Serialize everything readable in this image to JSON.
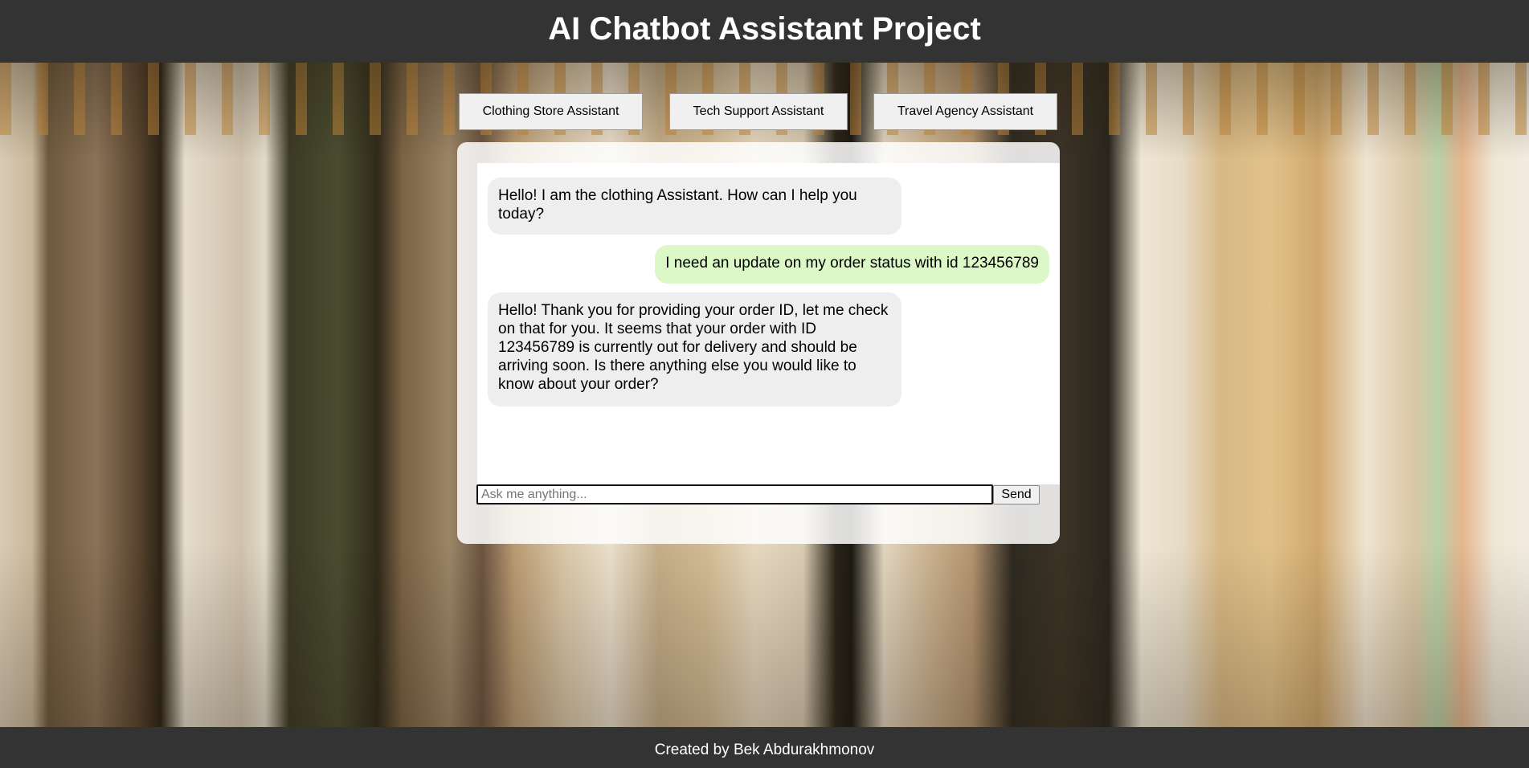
{
  "header": {
    "title": "AI Chatbot Assistant Project"
  },
  "tabs": [
    {
      "label": "Clothing Store Assistant"
    },
    {
      "label": "Tech Support Assistant"
    },
    {
      "label": "Travel Agency Assistant"
    }
  ],
  "chat": {
    "messages": [
      {
        "role": "bot",
        "text": "Hello! I am the clothing Assistant. How can I help you today?"
      },
      {
        "role": "user",
        "text": "I need an update on my order status with id 123456789"
      },
      {
        "role": "bot",
        "text": "Hello! Thank you for providing your order ID, let me check on that for you. It seems that your order with ID 123456789 is currently out for delivery and should be arriving soon. Is there anything else you would like to know about your order?"
      }
    ],
    "input_placeholder": "Ask me anything...",
    "input_value": "",
    "send_label": "Send"
  },
  "footer": {
    "text": "Created by Bek Abdurakhmonov"
  },
  "colors": {
    "header_bg": "#333333",
    "bot_bubble": "#eeeeee",
    "user_bubble": "#dcf8c6"
  }
}
